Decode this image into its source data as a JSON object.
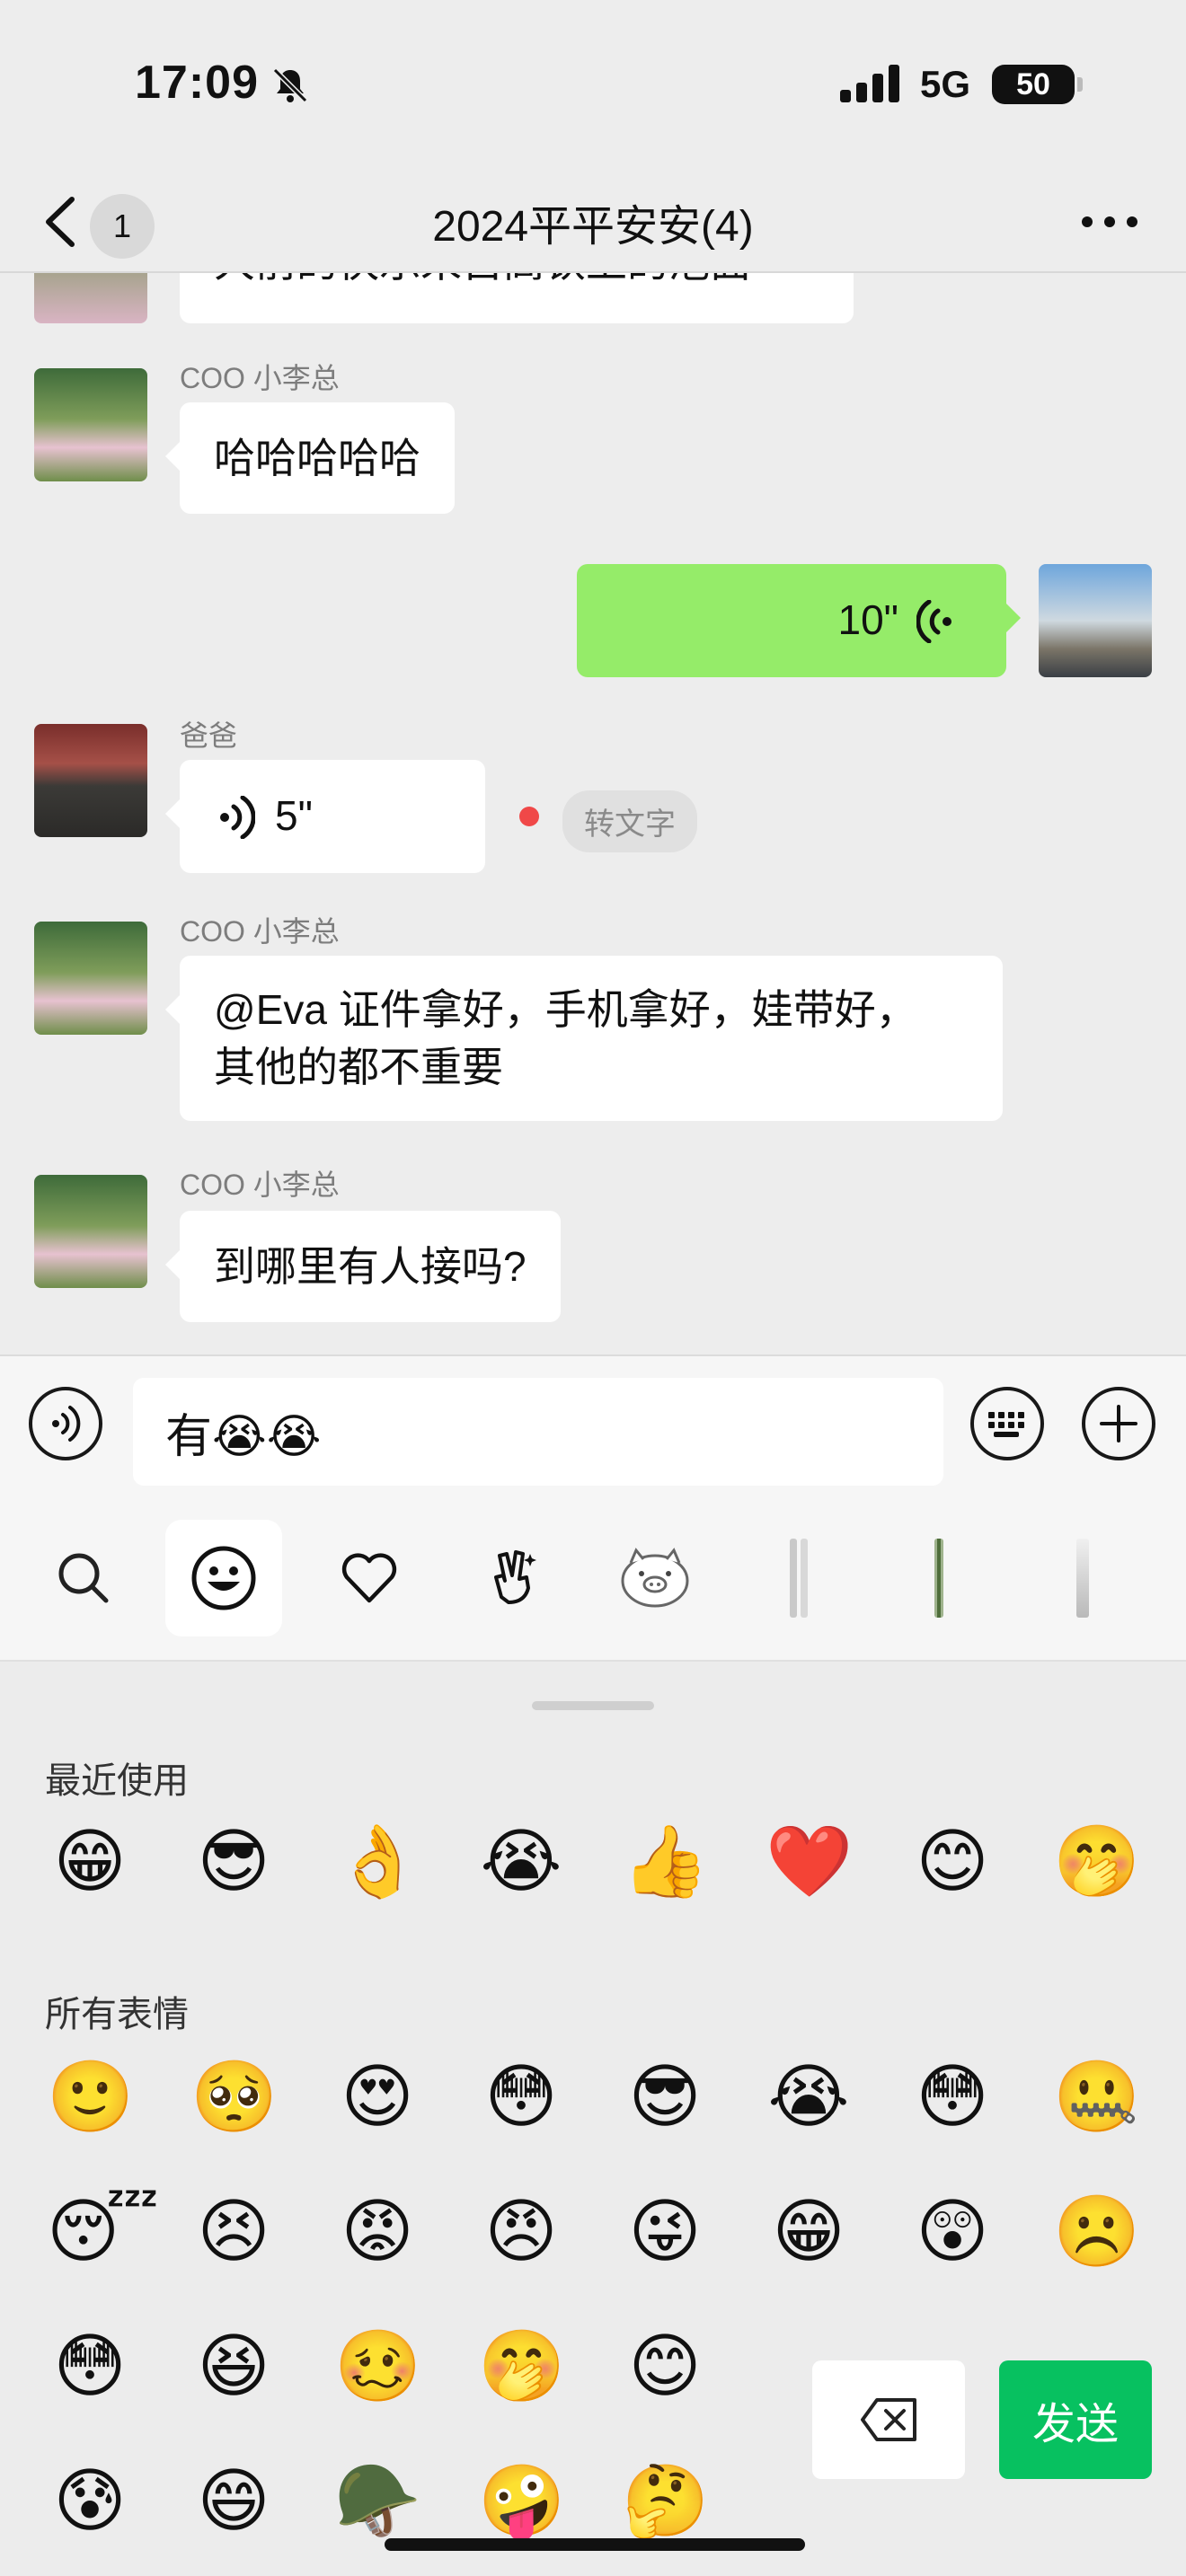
{
  "status_bar": {
    "time": "17:09",
    "network": "5G",
    "battery": "50"
  },
  "nav": {
    "unread_count": "1",
    "title": "2024平平安安(4)"
  },
  "messages": [
    {
      "sender": "COO 小李总",
      "text": "哈哈哈哈哈"
    },
    {
      "sender": "me",
      "voice_duration": "10\""
    },
    {
      "sender": "爸爸",
      "voice_duration": "5\"",
      "action": "转文字"
    },
    {
      "sender": "COO 小李总",
      "text_line1": "@Eva 证件拿好，手机拿好，娃带好，",
      "text_line2": "其他的都不重要"
    },
    {
      "sender": "COO 小李总",
      "text": "到哪里有人接吗?"
    }
  ],
  "partial_message_text": "大前的快乐来自高铁上的泡面",
  "input": {
    "value": "有😭😭"
  },
  "panel": {
    "recent_label": "最近使用",
    "all_label": "所有表情",
    "send_label": "发送",
    "recent_emojis": [
      "😁",
      "😎",
      "👌",
      "😭",
      "👍",
      "❤️",
      "😊",
      "🤭"
    ],
    "all_emojis_row1": [
      "🙂",
      "🥺",
      "😍",
      "😳",
      "😎",
      "😭",
      "😳",
      "🤐"
    ],
    "all_emojis_row2": [
      "😴",
      "😣",
      "😡",
      "😠",
      "😜",
      "😁",
      "😲",
      "☹️"
    ],
    "all_emojis_row3": [
      "😳",
      "😆",
      "🥴",
      "🤭",
      "😊"
    ],
    "all_emojis_row4": [
      "😰",
      "😄",
      "🪖",
      "🤪",
      "🤔"
    ]
  }
}
